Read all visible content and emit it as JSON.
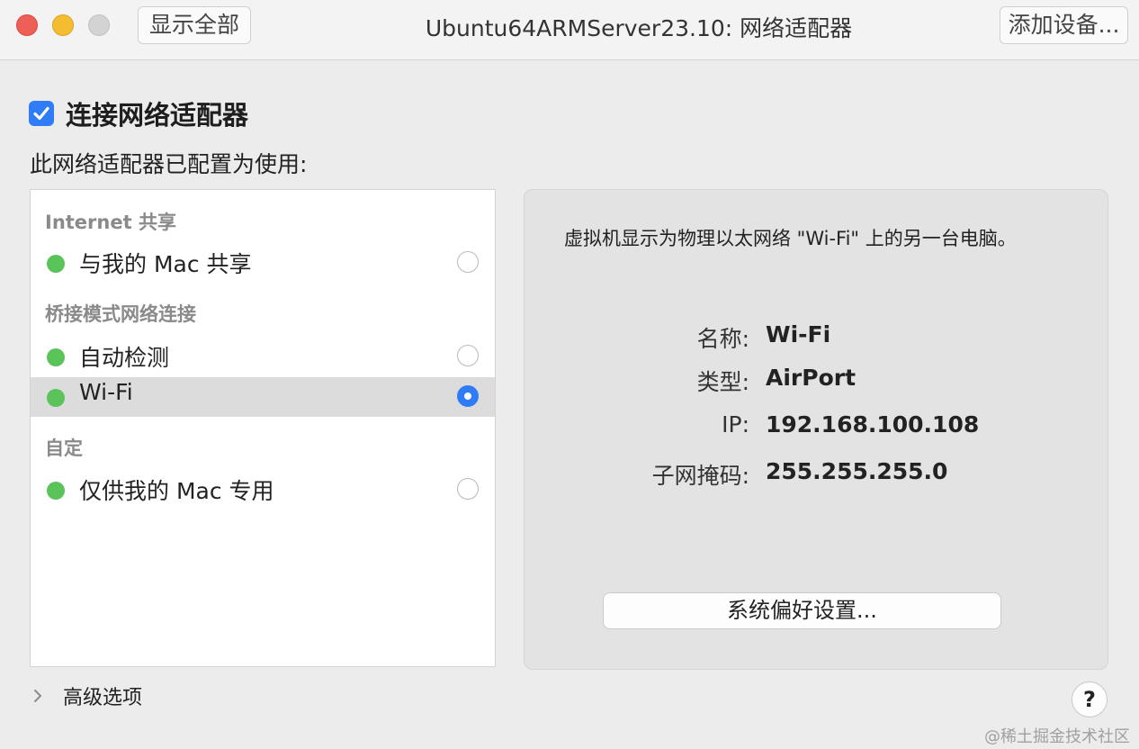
{
  "titlebar": {
    "show_all_label": "显示全部",
    "title": "Ubuntu64ARMServer23.10: 网络适配器",
    "add_device_label": "添加设备..."
  },
  "connect": {
    "label": "连接网络适配器",
    "checked": true
  },
  "configured_label": "此网络适配器已配置为使用:",
  "list": {
    "sections": [
      {
        "header": "Internet 共享",
        "items": [
          {
            "label": "与我的 Mac 共享",
            "selected": false
          }
        ]
      },
      {
        "header": "桥接模式网络连接",
        "items": [
          {
            "label": "自动检测",
            "selected": false
          },
          {
            "label": "Wi-Fi",
            "selected": true
          }
        ]
      },
      {
        "header": "自定",
        "items": [
          {
            "label": "仅供我的 Mac 专用",
            "selected": false
          }
        ]
      }
    ]
  },
  "info": {
    "description": "虚拟机显示为物理以太网络 \"Wi-Fi\" 上的另一台电脑。",
    "fields": [
      {
        "label": "名称:",
        "value": "Wi-Fi"
      },
      {
        "label": "类型:",
        "value": "AirPort"
      },
      {
        "label": "IP:",
        "value": "192.168.100.108"
      },
      {
        "label": "子网掩码:",
        "value": "255.255.255.0"
      }
    ],
    "prefs_button_label": "系统偏好设置..."
  },
  "advanced_label": "高级选项",
  "help_label": "?",
  "watermark": "@稀土掘金技术社区",
  "colors": {
    "accent": "#2f7cf6",
    "status_green": "#5ac35a",
    "close": "#ee5f57",
    "minimize": "#f4bd2f"
  }
}
